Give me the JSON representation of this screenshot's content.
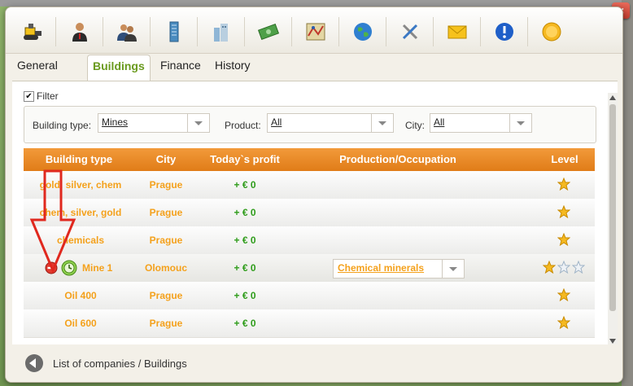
{
  "toolbar": {
    "buttons": [
      {
        "icon": "bulldozer-icon"
      },
      {
        "icon": "manager-icon"
      },
      {
        "icon": "people-icon"
      },
      {
        "icon": "building-icon"
      },
      {
        "icon": "factory-icon"
      },
      {
        "icon": "money-icon"
      },
      {
        "icon": "map-icon"
      },
      {
        "icon": "globe-icon"
      },
      {
        "icon": "tools-icon"
      },
      {
        "icon": "mail-icon"
      },
      {
        "icon": "info-icon"
      },
      {
        "icon": "coin-icon"
      }
    ]
  },
  "tabs": [
    {
      "label": "General Info"
    },
    {
      "label": "Buildings"
    },
    {
      "label": "Finance"
    },
    {
      "label": "History"
    }
  ],
  "filter": {
    "label": "Filter",
    "checked": true,
    "building_type_label": "Building type:",
    "building_type_value": "Mines",
    "product_label": "Product:",
    "product_value": "All",
    "city_label": "City:",
    "city_value": "All"
  },
  "table": {
    "headers": [
      "Building type",
      "City",
      "Today`s profit",
      "Production/Occupation",
      "Level"
    ],
    "rows": [
      {
        "name": "gold, silver, chem",
        "city": "Prague",
        "profit": "+ € 0",
        "level": 1
      },
      {
        "name": "chem, silver, gold",
        "city": "Prague",
        "profit": "+ € 0",
        "level": 1
      },
      {
        "name": "chemicals",
        "city": "Prague",
        "profit": "+ € 0",
        "level": 1
      },
      {
        "name": "Mine 1",
        "city": "Olomouc",
        "profit": "+ € 0",
        "production": "Chemical minerals",
        "level": 1
      },
      {
        "name": "Oil 400",
        "city": "Prague",
        "profit": "+ € 0",
        "level": 1
      },
      {
        "name": "Oil 600",
        "city": "Prague",
        "profit": "+ € 0",
        "level": 1
      }
    ]
  },
  "footer": {
    "breadcrumb": "List of companies / Buildings"
  },
  "colors": {
    "header_orange": "#e88a28",
    "text_orange": "#f4a11c",
    "profit_green": "#2e9c1a",
    "active_tab": "#6a9a1e",
    "arrow_red": "#e0281e"
  }
}
